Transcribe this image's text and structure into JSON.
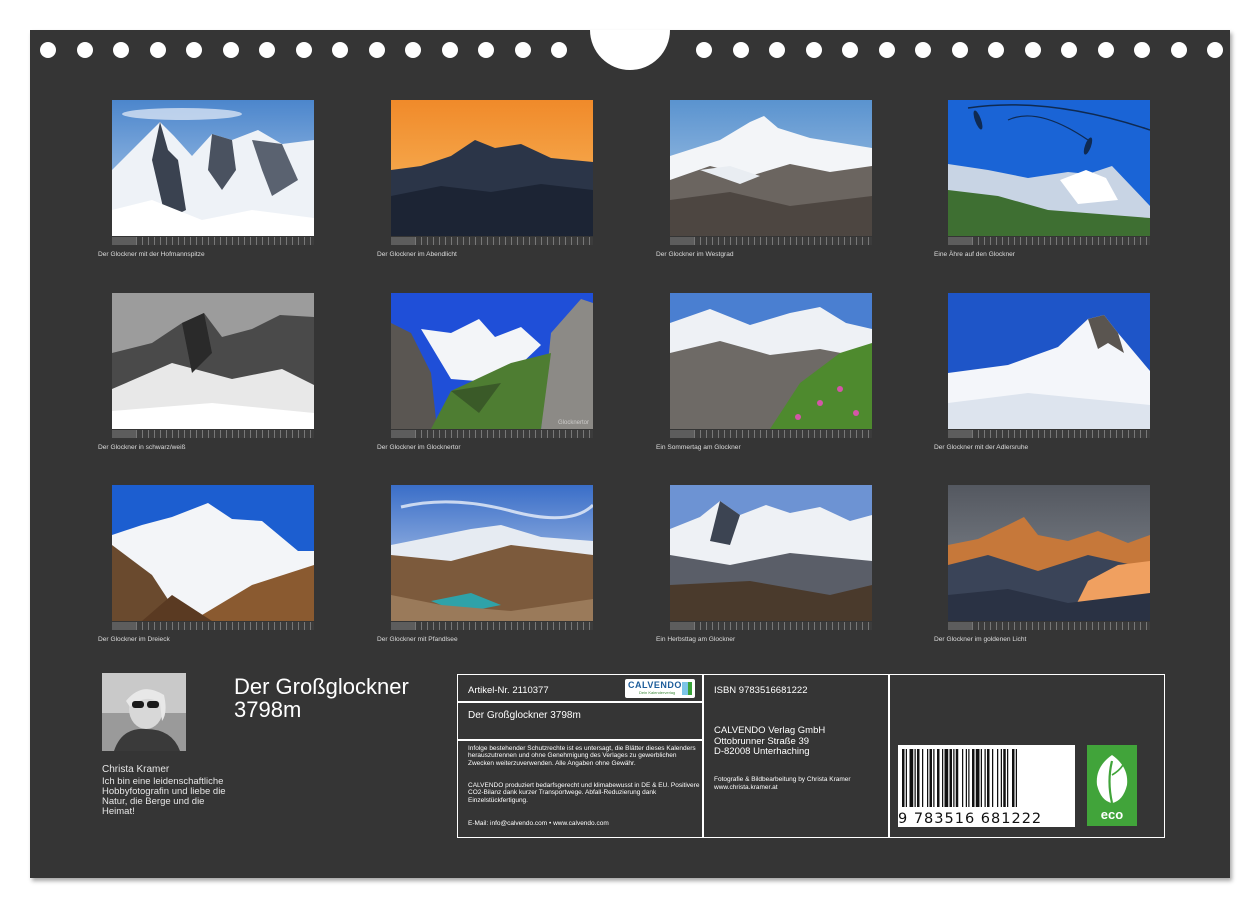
{
  "months": [
    {
      "caption": "Der Glockner mit der Hofmannspitze",
      "scene": "peak-glacier"
    },
    {
      "caption": "Der Glockner im Abendlicht",
      "scene": "sunset"
    },
    {
      "caption": "Der Glockner im Westgrad",
      "scene": "ridge"
    },
    {
      "caption": "Eine Ähre auf den Glockner",
      "scene": "grass"
    },
    {
      "caption": "Der Glockner in schwarz/weiß",
      "scene": "bw"
    },
    {
      "caption": "Der Glockner im Glocknertor",
      "scene": "gate"
    },
    {
      "caption": "Ein Sommertag am Glockner",
      "scene": "summer"
    },
    {
      "caption": "Der Glockner mit der Adlersruhe",
      "scene": "snowfield"
    },
    {
      "caption": "Der Glockner im Dreieck",
      "scene": "triangle"
    },
    {
      "caption": "Der Glockner mit Pfandlsee",
      "scene": "lake"
    },
    {
      "caption": "Ein Herbsttag am Glockner",
      "scene": "autumn"
    },
    {
      "caption": "Der Glockner im goldenen Licht",
      "scene": "golden"
    }
  ],
  "photo_mark": "Glocknertor",
  "author": {
    "name": "Christa Kramer",
    "bio": "Ich bin eine leidenschaftliche Hobbyfotografin und liebe die Natur, die Berge und die Heimat!"
  },
  "title_line1": "Der Großglockner",
  "title_line2": "3798m",
  "info": {
    "article": "Artikel-Nr. 2110377",
    "calendar_title": "Der Großglockner 3798m",
    "logo_text": "CALVENDO",
    "logo_sub": "Dein Kalenderverlag",
    "legal": "Infolge bestehender Schutzrechte ist es untersagt, die Blätter dieses Kalenders herauszutrennen und ohne Genehmigung des Verlages zu gewerblichen Zwecken weiterzuverwenden. Alle Angaben ohne Gewähr.",
    "eco_text": "CALVENDO produziert bedarfsgerecht und klimabewusst in DE & EU. Positivere CO2-Bilanz dank kurzer Transportwege. Abfall-Reduzierung dank Einzelstückfertigung.",
    "contact": "E-Mail: info@calvendo.com • www.calvendo.com",
    "isbn": "ISBN 9783516681222",
    "publisher_name": "CALVENDO Verlag GmbH",
    "publisher_street": "Ottobrunner Straße 39",
    "publisher_city": "D-82008 Unterhaching",
    "credit_line1": "Fotografie & Bildbearbeitung by Christa Kramer",
    "credit_line2": "www.christa.kramer.at",
    "barcode_digits": "9 783516 681222",
    "eco_label": "eco"
  },
  "colors": {
    "board": "#353535",
    "eco_green": "#41a43a",
    "calvendo_blue": "#1c5c9a"
  }
}
